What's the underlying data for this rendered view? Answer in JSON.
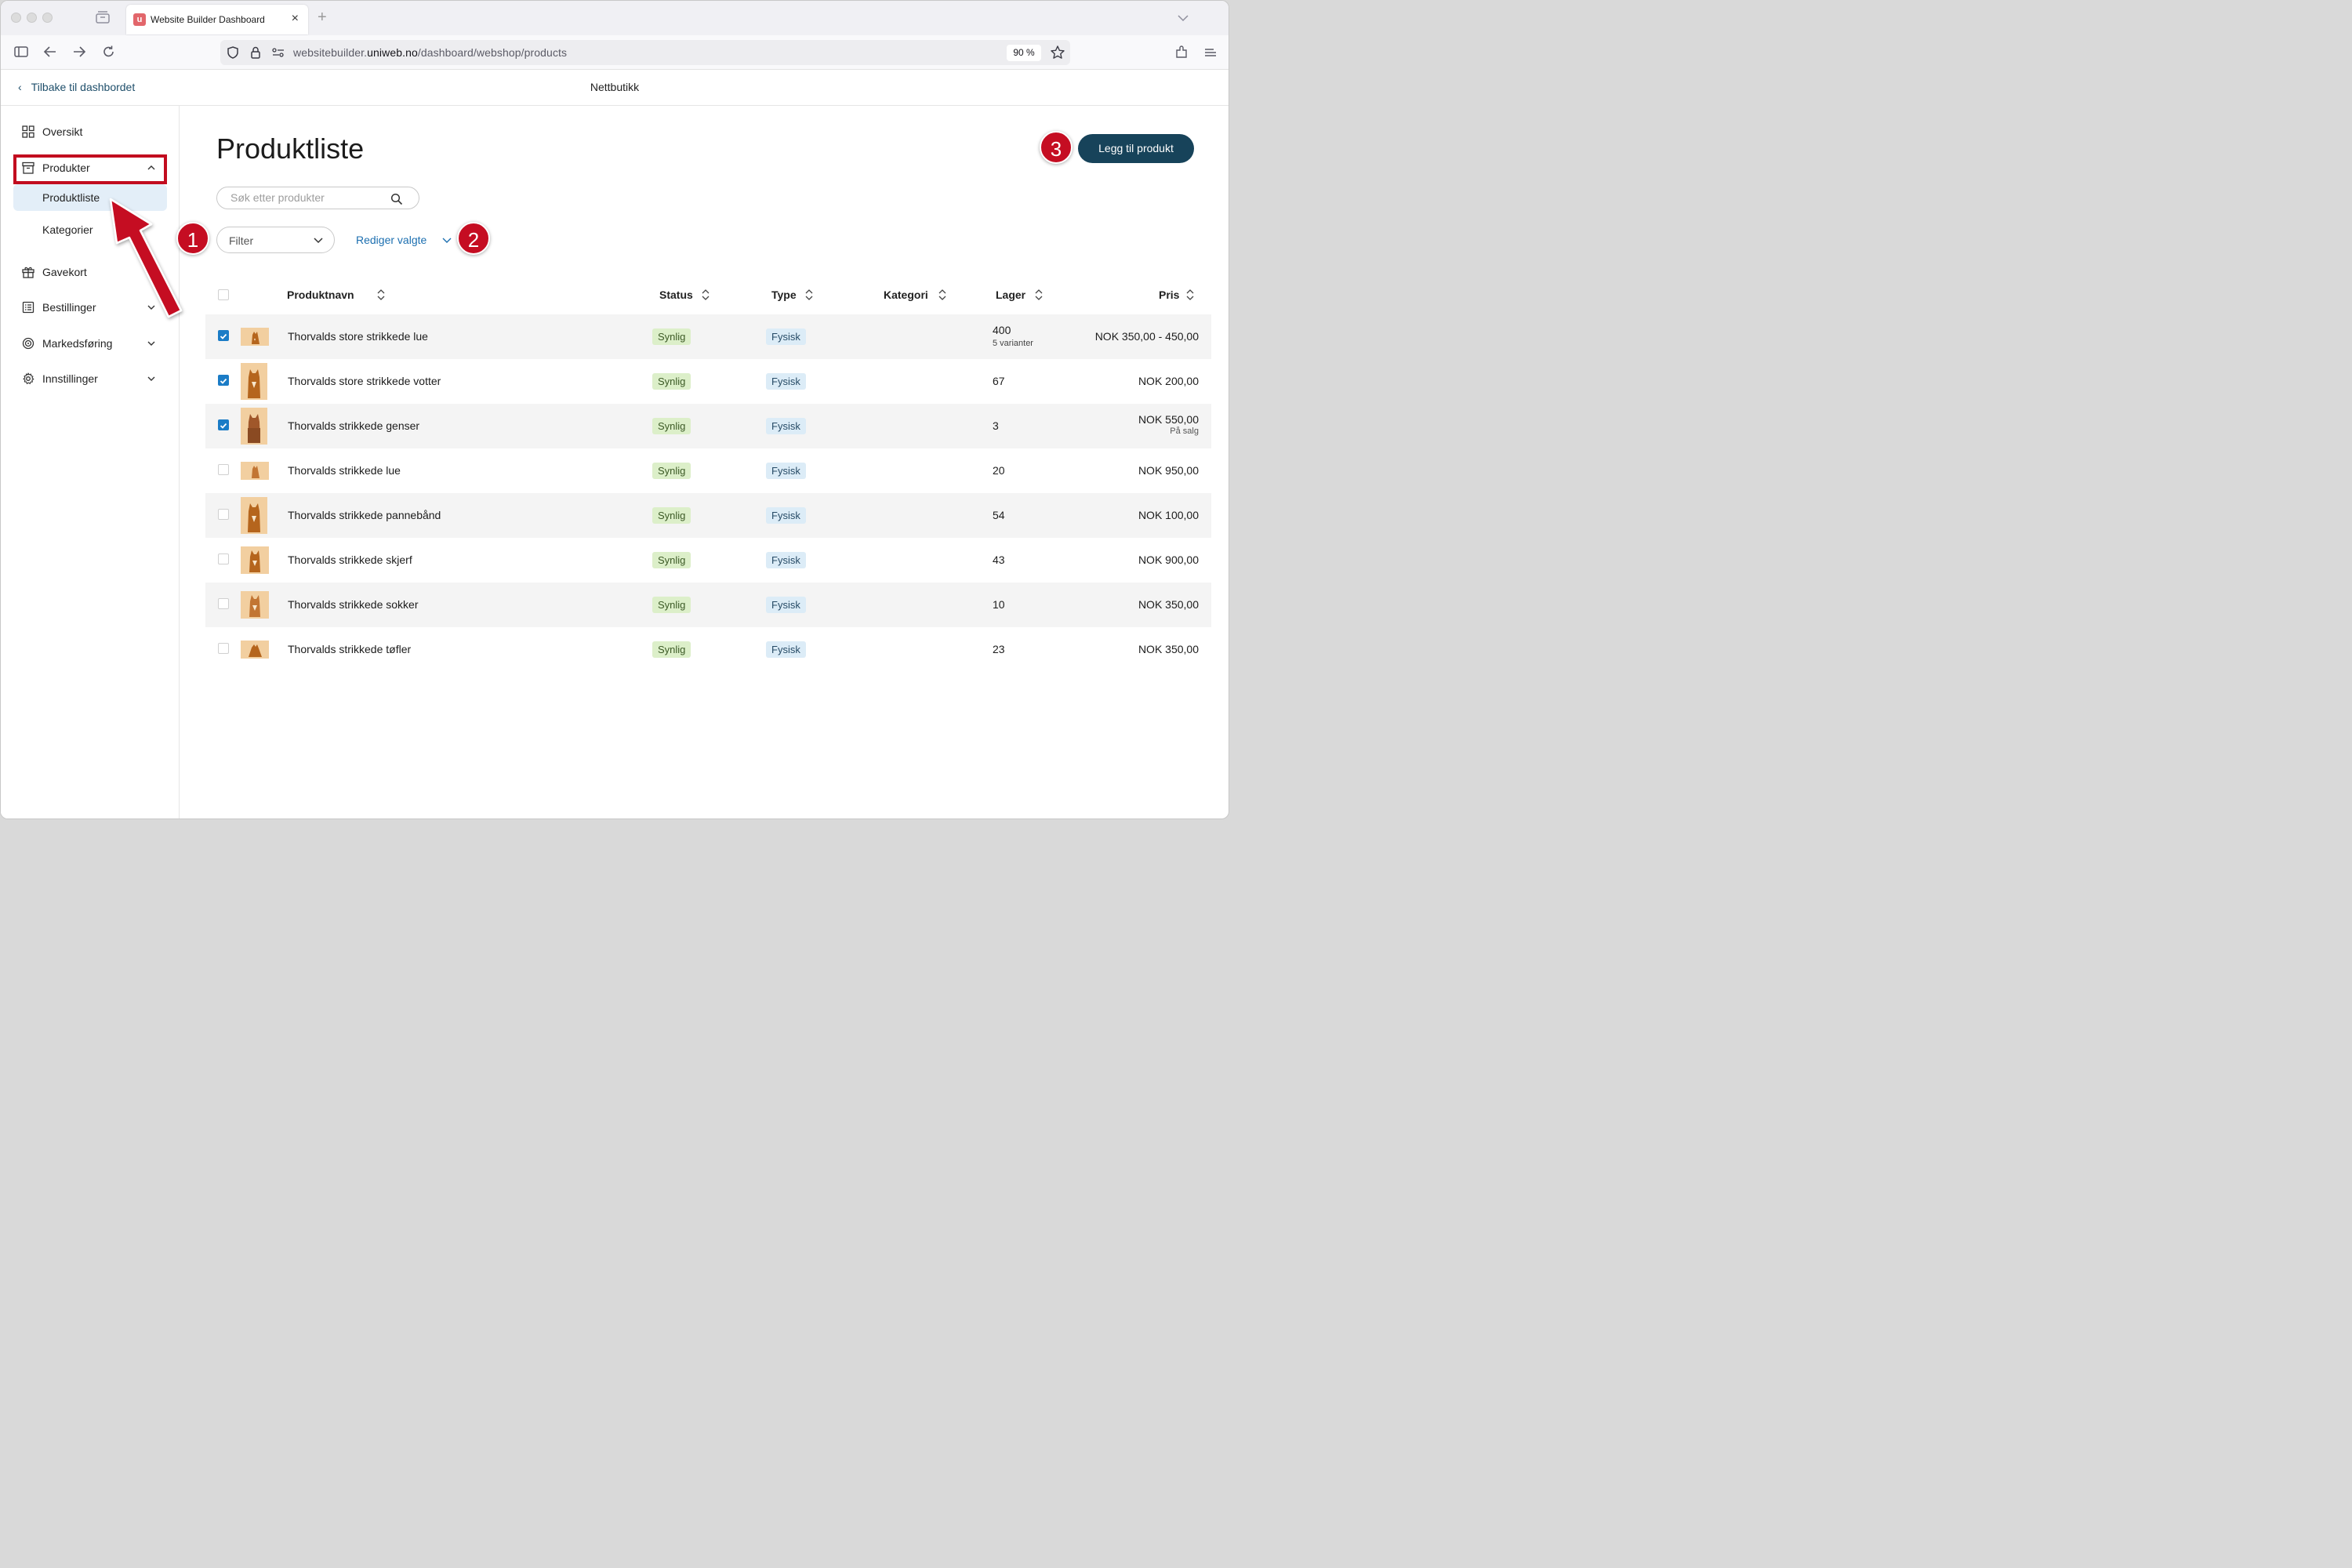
{
  "browser": {
    "tab_title": "Website Builder Dashboard",
    "favicon_letter": "u",
    "url_prefix": "websitebuilder.",
    "url_domain": "uniweb.no",
    "url_path": "/dashboard/webshop/products",
    "zoom": "90 %"
  },
  "header": {
    "back_label": "Tilbake til dashbordet",
    "title": "Nettbutikk"
  },
  "sidebar": {
    "items": [
      {
        "label": "Oversikt",
        "icon": "grid-icon"
      },
      {
        "label": "Produkter",
        "icon": "archive-box-icon",
        "expanded": true
      },
      {
        "label": "Gavekort",
        "icon": "gift-icon"
      },
      {
        "label": "Bestillinger",
        "icon": "list-icon"
      },
      {
        "label": "Markedsføring",
        "icon": "target-icon"
      },
      {
        "label": "Innstillinger",
        "icon": "gear-icon"
      }
    ],
    "sub_items": [
      {
        "label": "Produktliste",
        "active": true
      },
      {
        "label": "Kategorier",
        "active": false
      }
    ]
  },
  "main": {
    "title": "Produktliste",
    "add_button": "Legg til produkt",
    "search_placeholder": "Søk etter produkter",
    "filter_label": "Filter",
    "edit_selected": "Rediger valgte"
  },
  "annotations": [
    "1",
    "2",
    "3"
  ],
  "table": {
    "columns": [
      "Produktnavn",
      "Status",
      "Type",
      "Kategori",
      "Lager",
      "Pris"
    ],
    "rows": [
      {
        "checked": true,
        "name": "Thorvalds store strikkede lue",
        "status": "Synlig",
        "type": "Fysisk",
        "category": "",
        "stock": "400",
        "stock_sub": "5 varianter",
        "price": "NOK 350,00 - 450,00",
        "price_sub": ""
      },
      {
        "checked": true,
        "name": "Thorvalds store strikkede votter",
        "status": "Synlig",
        "type": "Fysisk",
        "category": "",
        "stock": "67",
        "stock_sub": "",
        "price": "NOK 200,00",
        "price_sub": ""
      },
      {
        "checked": true,
        "name": "Thorvalds strikkede genser",
        "status": "Synlig",
        "type": "Fysisk",
        "category": "",
        "stock": "3",
        "stock_sub": "",
        "price": "NOK 550,00",
        "price_sub": "På salg"
      },
      {
        "checked": false,
        "name": "Thorvalds strikkede lue",
        "status": "Synlig",
        "type": "Fysisk",
        "category": "",
        "stock": "20",
        "stock_sub": "",
        "price": "NOK 950,00",
        "price_sub": ""
      },
      {
        "checked": false,
        "name": "Thorvalds strikkede pannebånd",
        "status": "Synlig",
        "type": "Fysisk",
        "category": "",
        "stock": "54",
        "stock_sub": "",
        "price": "NOK 100,00",
        "price_sub": ""
      },
      {
        "checked": false,
        "name": "Thorvalds strikkede skjerf",
        "status": "Synlig",
        "type": "Fysisk",
        "category": "",
        "stock": "43",
        "stock_sub": "",
        "price": "NOK 900,00",
        "price_sub": ""
      },
      {
        "checked": false,
        "name": "Thorvalds strikkede sokker",
        "status": "Synlig",
        "type": "Fysisk",
        "category": "",
        "stock": "10",
        "stock_sub": "",
        "price": "NOK 350,00",
        "price_sub": ""
      },
      {
        "checked": false,
        "name": "Thorvalds strikkede tøfler",
        "status": "Synlig",
        "type": "Fysisk",
        "category": "",
        "stock": "23",
        "stock_sub": "",
        "price": "NOK 350,00",
        "price_sub": ""
      }
    ]
  },
  "colors": {
    "accent": "#17435a",
    "link": "#1c6fb0",
    "annotation_red": "#c50d22",
    "status_bg": "#dcefc9",
    "type_bg": "#dcecf7",
    "checkbox": "#1b7cc6"
  }
}
